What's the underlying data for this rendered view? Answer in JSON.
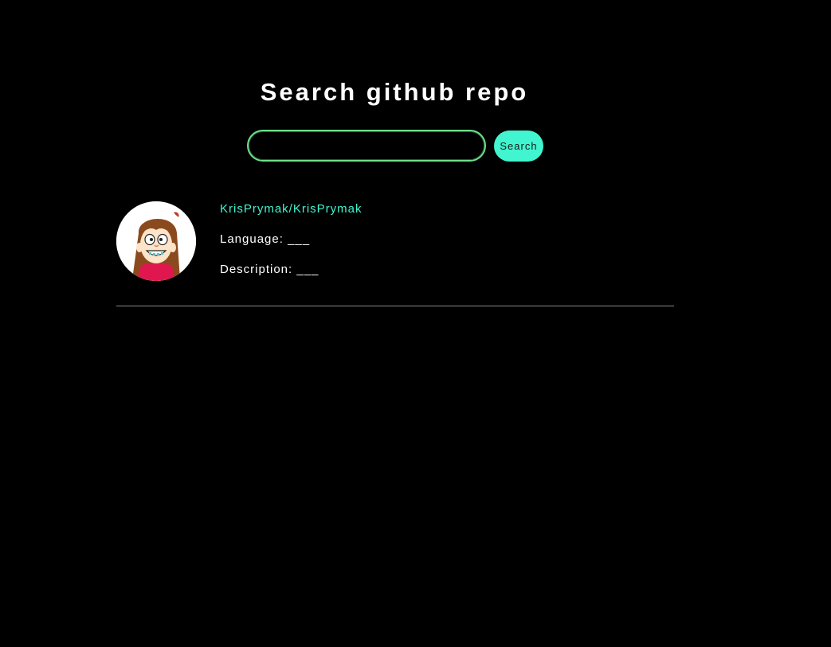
{
  "header": {
    "title": "Search github repo"
  },
  "search": {
    "value": "",
    "placeholder": "",
    "button_label": "Search"
  },
  "results": [
    {
      "full_name": "KrisPrymak/KrisPrymak",
      "language_label": "Language:",
      "language_value": "___",
      "description_label": "Description:",
      "description_value": "___",
      "avatar_icon": "cartoon-girl-avatar"
    }
  ],
  "colors": {
    "background": "#000000",
    "accent": "#40f5cf",
    "input_border": "#6ee08a",
    "divider": "#8a8a8a"
  }
}
